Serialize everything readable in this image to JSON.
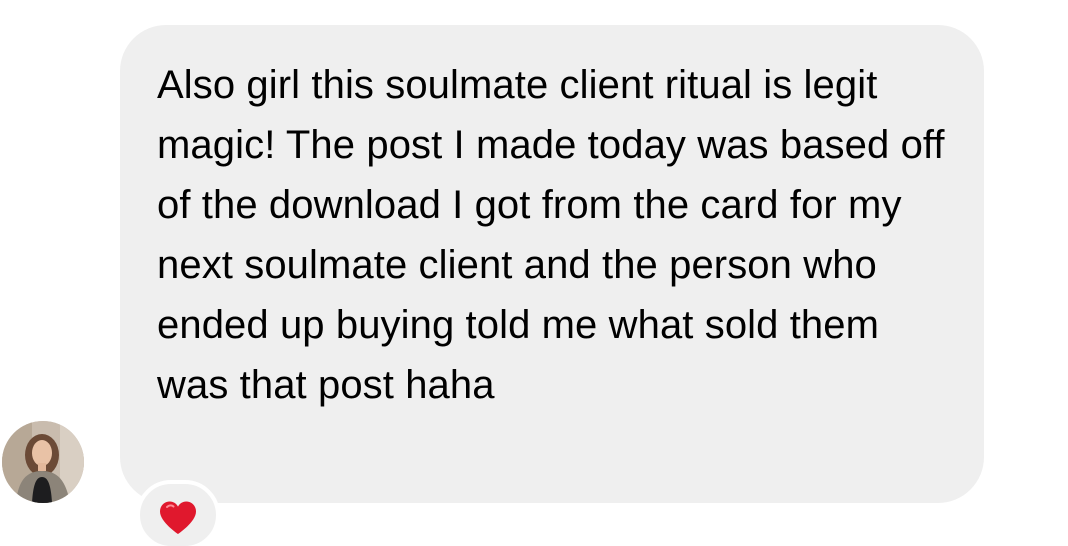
{
  "message": {
    "text": "Also girl this soulmate client ritual is legit magic! The post I made today was based off of the download I got from the card for my next soulmate client and the person who ended up buying told me what sold them was that post haha",
    "reaction": "❤️",
    "reaction_icon": "red-heart-icon",
    "bubble_color": "#efefef",
    "reaction_color": "#e0182d"
  },
  "sender": {
    "avatar_icon": "profile-photo"
  }
}
